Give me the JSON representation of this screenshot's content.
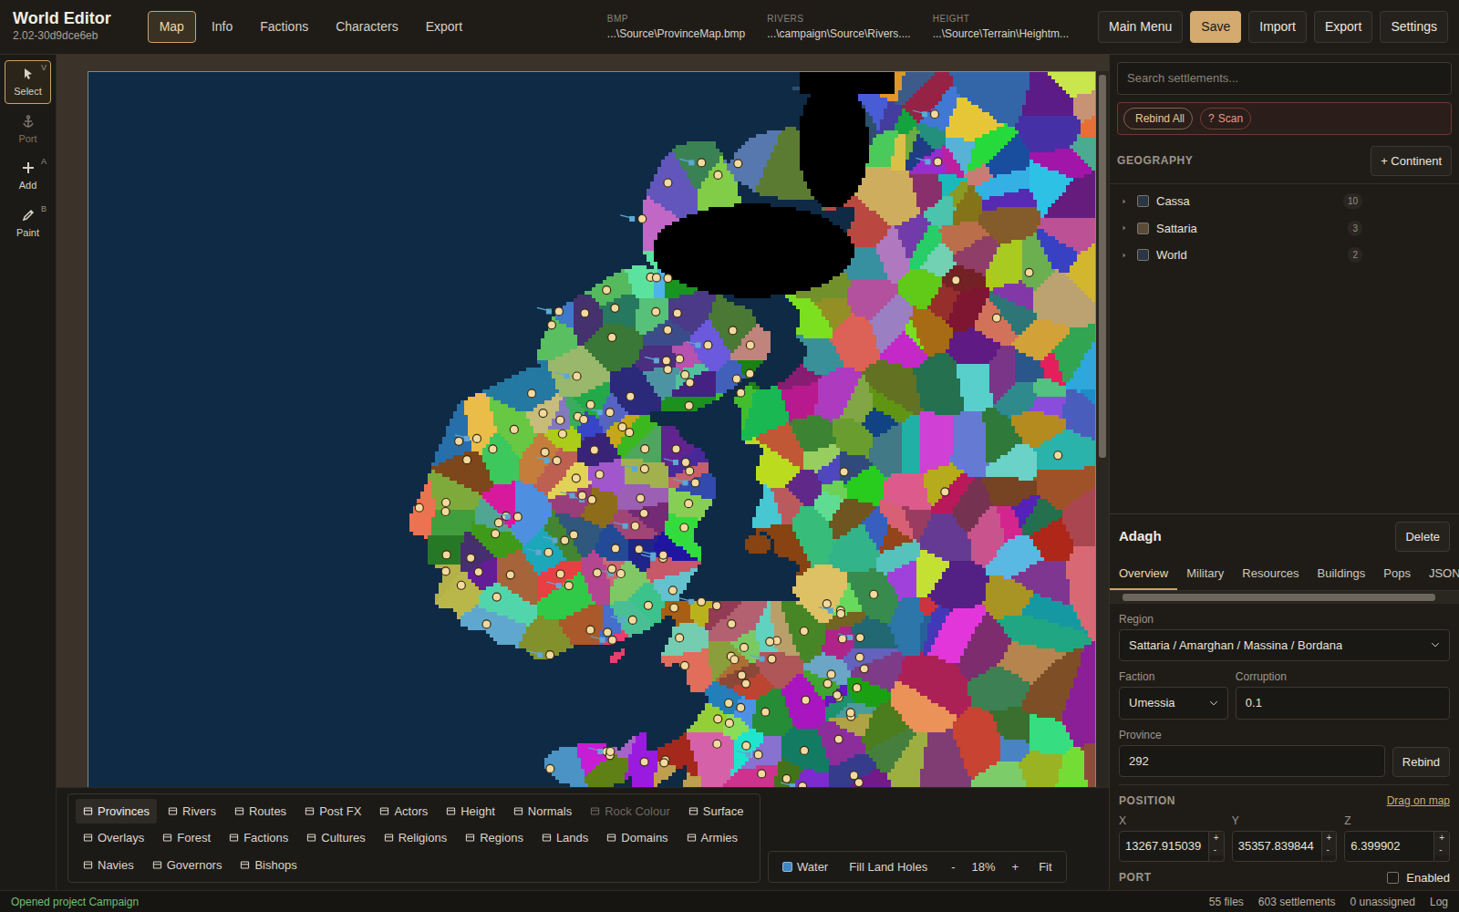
{
  "app": {
    "title": "World Editor",
    "version": "2.02-30d9dce6eb"
  },
  "nav_tabs": [
    {
      "label": "Map",
      "selected": true
    },
    {
      "label": "Info",
      "selected": false
    },
    {
      "label": "Factions",
      "selected": false
    },
    {
      "label": "Characters",
      "selected": false
    },
    {
      "label": "Export",
      "selected": false
    }
  ],
  "paths": [
    {
      "label": "BMP",
      "value": "...\\Source\\ProvinceMap.bmp"
    },
    {
      "label": "RIVERS",
      "value": "...\\campaign\\Source\\Rivers...."
    },
    {
      "label": "HEIGHT",
      "value": "...\\Source\\Terrain\\Heightm..."
    }
  ],
  "header_buttons": [
    {
      "label": "Main Menu",
      "kind": "default"
    },
    {
      "label": "Save",
      "kind": "primary"
    },
    {
      "label": "Import",
      "kind": "default"
    },
    {
      "label": "Export",
      "kind": "default"
    },
    {
      "label": "Settings",
      "kind": "default"
    }
  ],
  "tools": [
    {
      "label": "Select",
      "key": "V",
      "selected": true,
      "disabled": false
    },
    {
      "label": "Port",
      "selected": false,
      "disabled": true
    },
    {
      "label": "Add",
      "key": "A",
      "selected": false,
      "disabled": false
    },
    {
      "label": "Paint",
      "key": "B",
      "selected": false,
      "disabled": false
    }
  ],
  "layers": [
    {
      "label": "Provinces",
      "selected": true,
      "disabled": false
    },
    {
      "label": "Rivers",
      "selected": false,
      "disabled": false
    },
    {
      "label": "Routes",
      "selected": false,
      "disabled": false
    },
    {
      "label": "Post FX",
      "selected": false,
      "disabled": false
    },
    {
      "label": "Actors",
      "selected": false,
      "disabled": false
    },
    {
      "label": "Height",
      "selected": false,
      "disabled": false
    },
    {
      "label": "Normals",
      "selected": false,
      "disabled": false
    },
    {
      "label": "Rock Colour",
      "selected": false,
      "disabled": true
    },
    {
      "label": "Surface",
      "selected": false,
      "disabled": false
    },
    {
      "label": "Overlays",
      "selected": false,
      "disabled": false
    },
    {
      "label": "Forest",
      "selected": false,
      "disabled": false
    },
    {
      "label": "Factions",
      "selected": false,
      "disabled": false
    },
    {
      "label": "Cultures",
      "selected": false,
      "disabled": false
    },
    {
      "label": "Religions",
      "selected": false,
      "disabled": false
    },
    {
      "label": "Regions",
      "selected": false,
      "disabled": false
    },
    {
      "label": "Lands",
      "selected": false,
      "disabled": false
    },
    {
      "label": "Domains",
      "selected": false,
      "disabled": false
    },
    {
      "label": "Armies",
      "selected": false,
      "disabled": false
    },
    {
      "label": "Navies",
      "selected": false,
      "disabled": false
    },
    {
      "label": "Governors",
      "selected": false,
      "disabled": false
    },
    {
      "label": "Bishops",
      "selected": false,
      "disabled": false
    }
  ],
  "view": {
    "water": {
      "label": "Water",
      "checked": true
    },
    "fill_holes": "Fill Land Holes",
    "zoom_out": "-",
    "zoom": "18%",
    "zoom_in": "+",
    "fit": "Fit"
  },
  "sidebar": {
    "search_placeholder": "Search settlements...",
    "rebind_all": "Rebind All",
    "scan_icon": "?",
    "scan": "Scan",
    "section": "GEOGRAPHY",
    "add_continent": "+ Continent",
    "continents": [
      {
        "name": "Cassa",
        "count": "10",
        "color": "#2b3644",
        "expanded": false
      },
      {
        "name": "Sattaria",
        "count": "3",
        "color": "#5a4a36",
        "expanded": false
      },
      {
        "name": "World",
        "count": "2",
        "color": "#2b3644",
        "expanded": false
      }
    ]
  },
  "settlement": {
    "name": "Adagh",
    "delete": "Delete",
    "tabs": [
      {
        "label": "Overview",
        "selected": true
      },
      {
        "label": "Military",
        "selected": false
      },
      {
        "label": "Resources",
        "selected": false
      },
      {
        "label": "Buildings",
        "selected": false
      },
      {
        "label": "Pops",
        "selected": false
      },
      {
        "label": "JSON",
        "selected": false
      }
    ],
    "region": {
      "label": "Region",
      "value": "Sattaria / Amarghan / Massina / Bordana"
    },
    "faction": {
      "label": "Faction",
      "value": "Umessia"
    },
    "corruption": {
      "label": "Corruption",
      "value": "0.1"
    },
    "province": {
      "label": "Province",
      "value": "292"
    },
    "rebind": "Rebind",
    "position": {
      "label": "POSITION",
      "drag": "Drag on map",
      "inc": "+",
      "dec": "-",
      "fields": [
        {
          "label": "X",
          "value": "13267.915039"
        },
        {
          "label": "Y",
          "value": "35357.839844"
        },
        {
          "label": "Z",
          "value": "6.399902"
        }
      ]
    },
    "port": {
      "label": "PORT",
      "option": "Enabled",
      "checked": false
    }
  },
  "status": {
    "message": "Opened project Campaign",
    "files": "55 files",
    "settlements": "603 settlements",
    "unassigned": "0 unassigned",
    "log": "Log"
  }
}
